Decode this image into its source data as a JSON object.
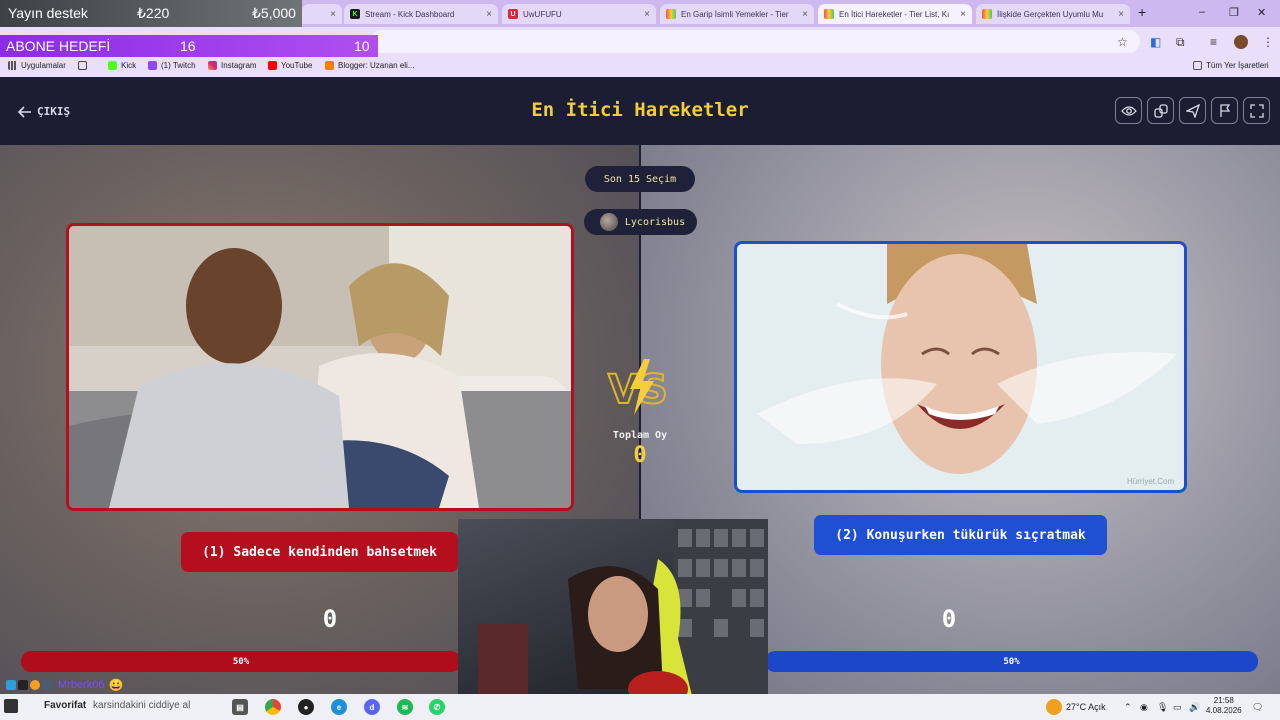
{
  "overlays": {
    "donation": {
      "label": "Yayın destek",
      "current": "₺220",
      "goal": "₺5,000"
    },
    "sub_goal": {
      "label": "ABONE HEDEFİ",
      "current": "16",
      "target": "10"
    }
  },
  "browser": {
    "tabs": [
      {
        "title": "",
        "icon": "generic-icon",
        "active": false
      },
      {
        "title": "Stream - Kick Dashboard",
        "icon": "kick-icon",
        "active": false
      },
      {
        "title": "UwUFUFU",
        "icon": "uwufufu-icon",
        "active": false
      },
      {
        "title": "En Garip İsimli Yemekler - Tier",
        "icon": "tierlist-icon",
        "active": false
      },
      {
        "title": "En İtici Hareketler - Tier List, Kı",
        "icon": "tierlist-icon",
        "active": true
      },
      {
        "title": "İlişkide Gerçekten Uyumlu Mu",
        "icon": "tierlist-icon",
        "active": false
      }
    ],
    "bookmarks": [
      {
        "label": "Uygulamalar",
        "icon": "apps-icon"
      },
      {
        "label": "Kick",
        "icon": "kick-icon"
      },
      {
        "label": "(1) Twitch",
        "icon": "twitch-icon"
      },
      {
        "label": "Instagram",
        "icon": "instagram-icon"
      },
      {
        "label": "YouTube",
        "icon": "youtube-icon"
      },
      {
        "label": "Blogger: Uzanan eli...",
        "icon": "blogger-icon"
      }
    ],
    "all_bookmarks": "Tüm Yer İşaretleri"
  },
  "page": {
    "exit_label": "ÇIKIŞ",
    "title": "En İtici Hareketler",
    "last_choices": "Son 15 Seçim",
    "creator": "Lycorisbus",
    "total_label": "Toplam Oy",
    "total_value": "0",
    "left": {
      "label": "(1) Sadece kendinden bahsetmek",
      "votes": "0",
      "percent": "50%",
      "color": "#b50f1f"
    },
    "right": {
      "label": "(2) Konuşurken tükürük sıçratmak",
      "votes": "0",
      "percent": "50%",
      "color": "#1f4fd2"
    },
    "image_watermark": "Hürriyet.Com"
  },
  "chat": {
    "user": "Mrberk06"
  },
  "taskbar": {
    "ticker_prefix": "Favorifat",
    "ticker_text": "karsindakini ciddiye al",
    "weather": "27°C  Açık",
    "time": "21:58",
    "date": "4.08.2026"
  }
}
